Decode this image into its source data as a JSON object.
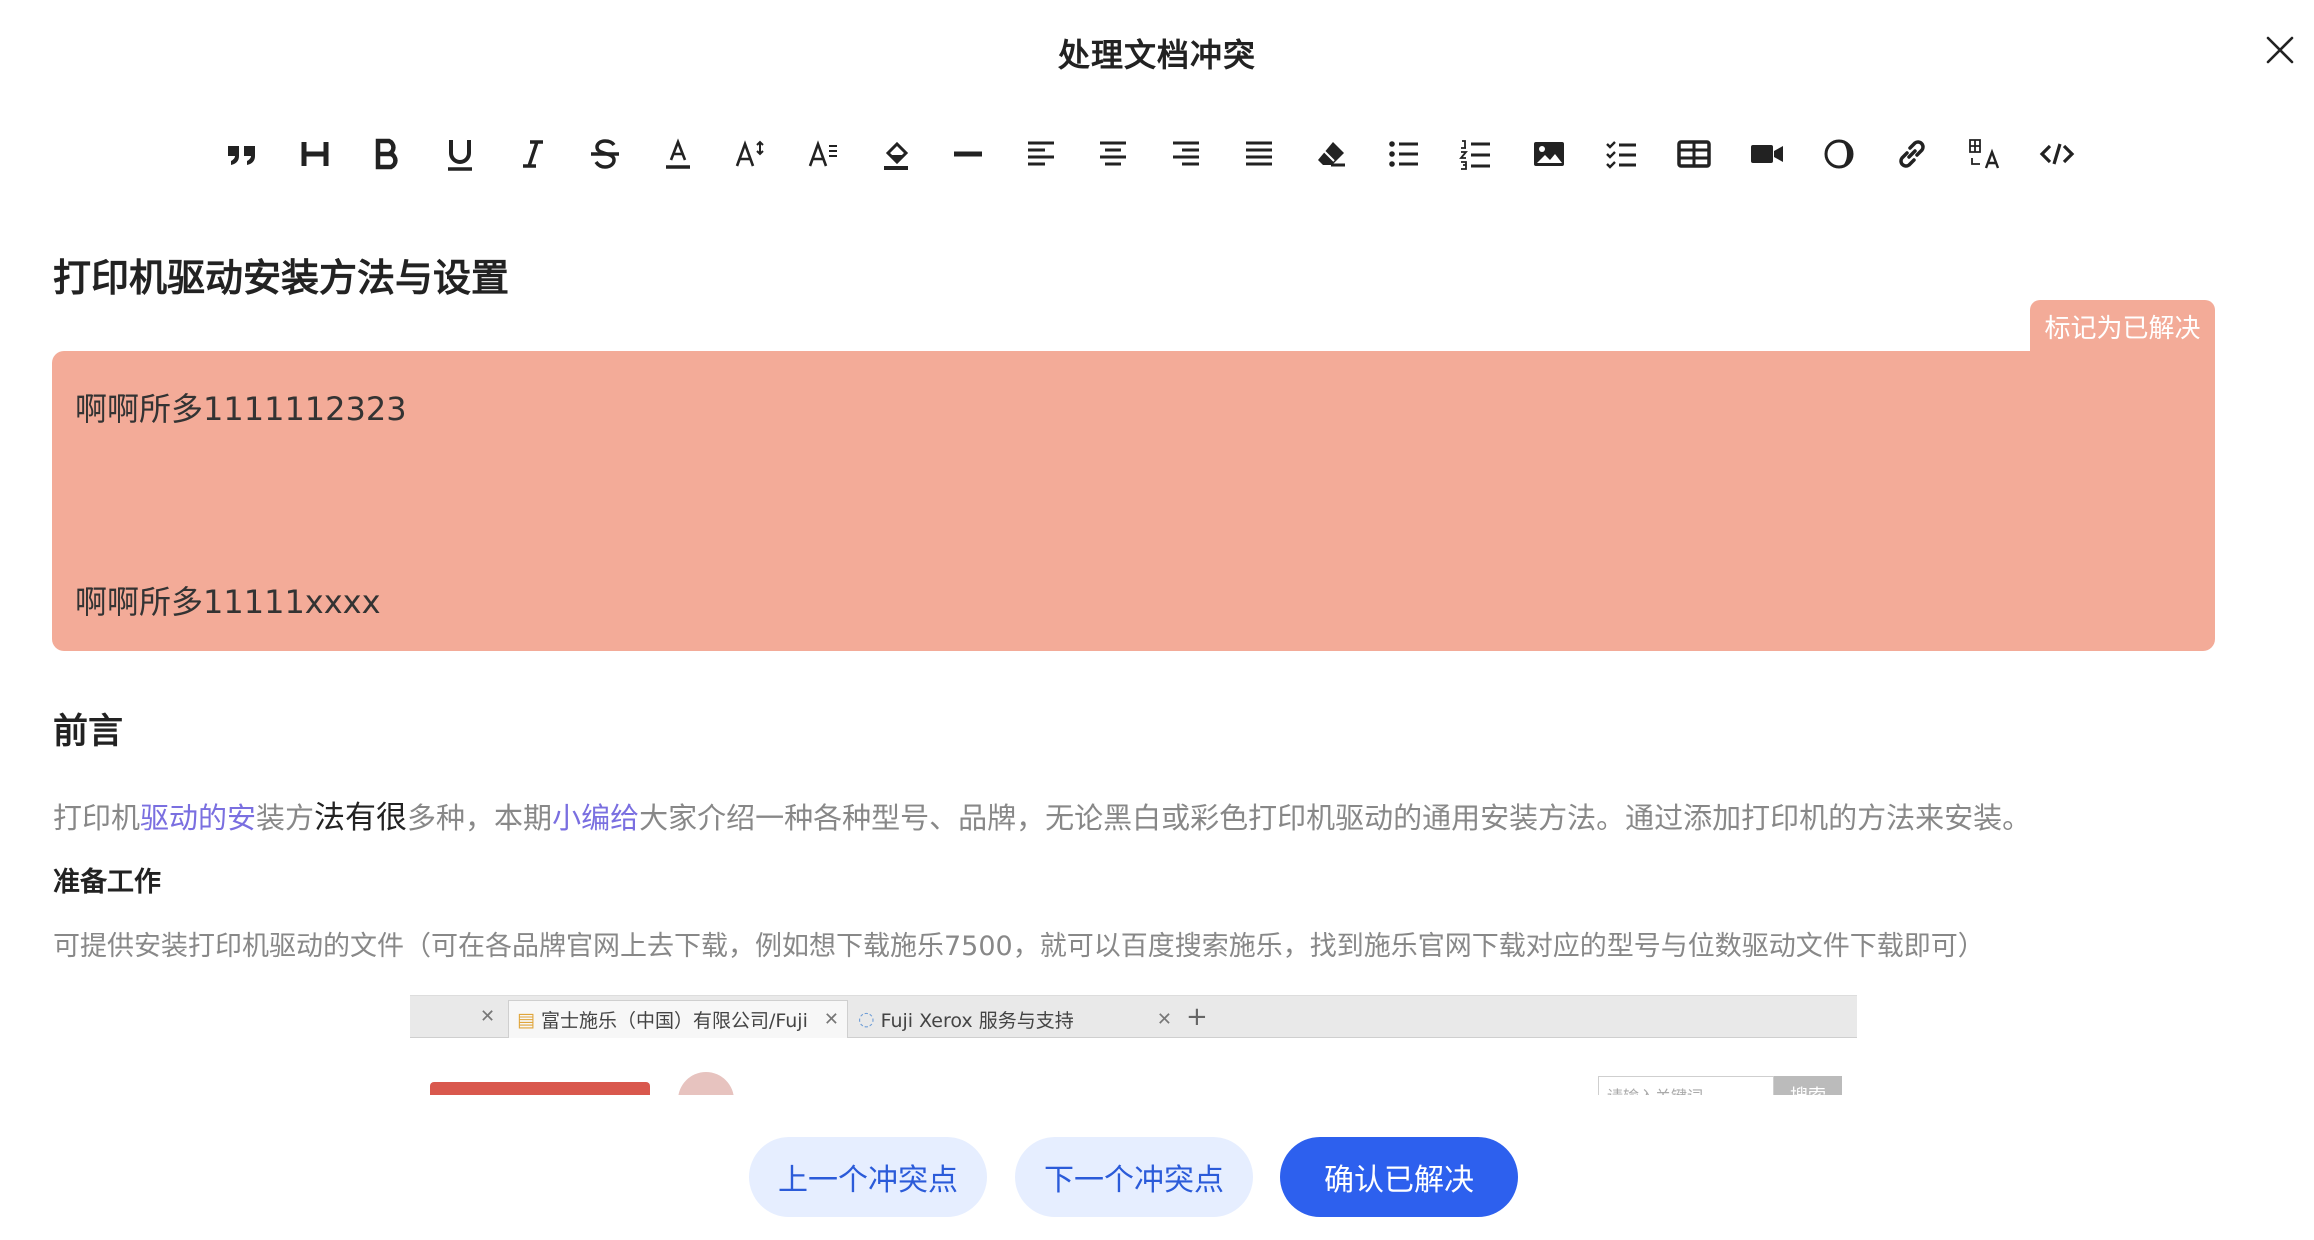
{
  "modal": {
    "title": "处理文档冲突"
  },
  "toolbar": {
    "tools": [
      "quote-icon",
      "heading-icon",
      "bold-icon",
      "underline-icon",
      "italic-icon",
      "strikethrough-icon",
      "font-color-icon",
      "font-size-icon",
      "line-height-icon",
      "highlight-icon",
      "horizontal-rule-icon",
      "align-left-icon",
      "align-center-icon",
      "align-right-icon",
      "align-justify-icon",
      "eraser-icon",
      "bullet-list-icon",
      "ordered-list-icon",
      "image-icon",
      "task-list-icon",
      "table-icon",
      "video-icon",
      "theme-icon",
      "link-icon",
      "translate-icon",
      "code-icon"
    ]
  },
  "document": {
    "title": "打印机驱动安装方法与设置",
    "conflict": {
      "resolve_label": "标记为已解决",
      "line_a": "啊啊所多1111112323",
      "line_b": "啊啊所多11111xxxx",
      "bg_color": "#f3ab98"
    },
    "section_heading": "前言",
    "intro": {
      "seg1": "打印机",
      "seg2": "驱动的安",
      "seg3": "装方",
      "seg4": "法有很",
      "seg5": "多种，本期",
      "seg6": "小编给",
      "seg7": "大家介绍一种各种型号、品牌，无论黑白或彩色打印机驱动的通用安装方法。通过添加打印机的方法来安装。"
    },
    "sub_heading": "准备工作",
    "note": "可提供安装打印机驱动的文件（可在各品牌官网上去下载，例如想下载施乐7500，就可以百度搜索施乐，找到施乐官网下载对应的型号与位数驱动文件下载即可）",
    "embedded": {
      "tab_active": "富士施乐（中国）有限公司/Fuji",
      "tab_second": "Fuji Xerox 服务与支持",
      "search_placeholder": "请输入关键词",
      "search_button": "搜索"
    }
  },
  "actions": {
    "prev": "上一个冲突点",
    "next": "下一个冲突点",
    "confirm": "确认已解决"
  },
  "colors": {
    "primary": "#2d60ee",
    "primary_light": "#e6eeff",
    "link": "#7a6fe0"
  }
}
